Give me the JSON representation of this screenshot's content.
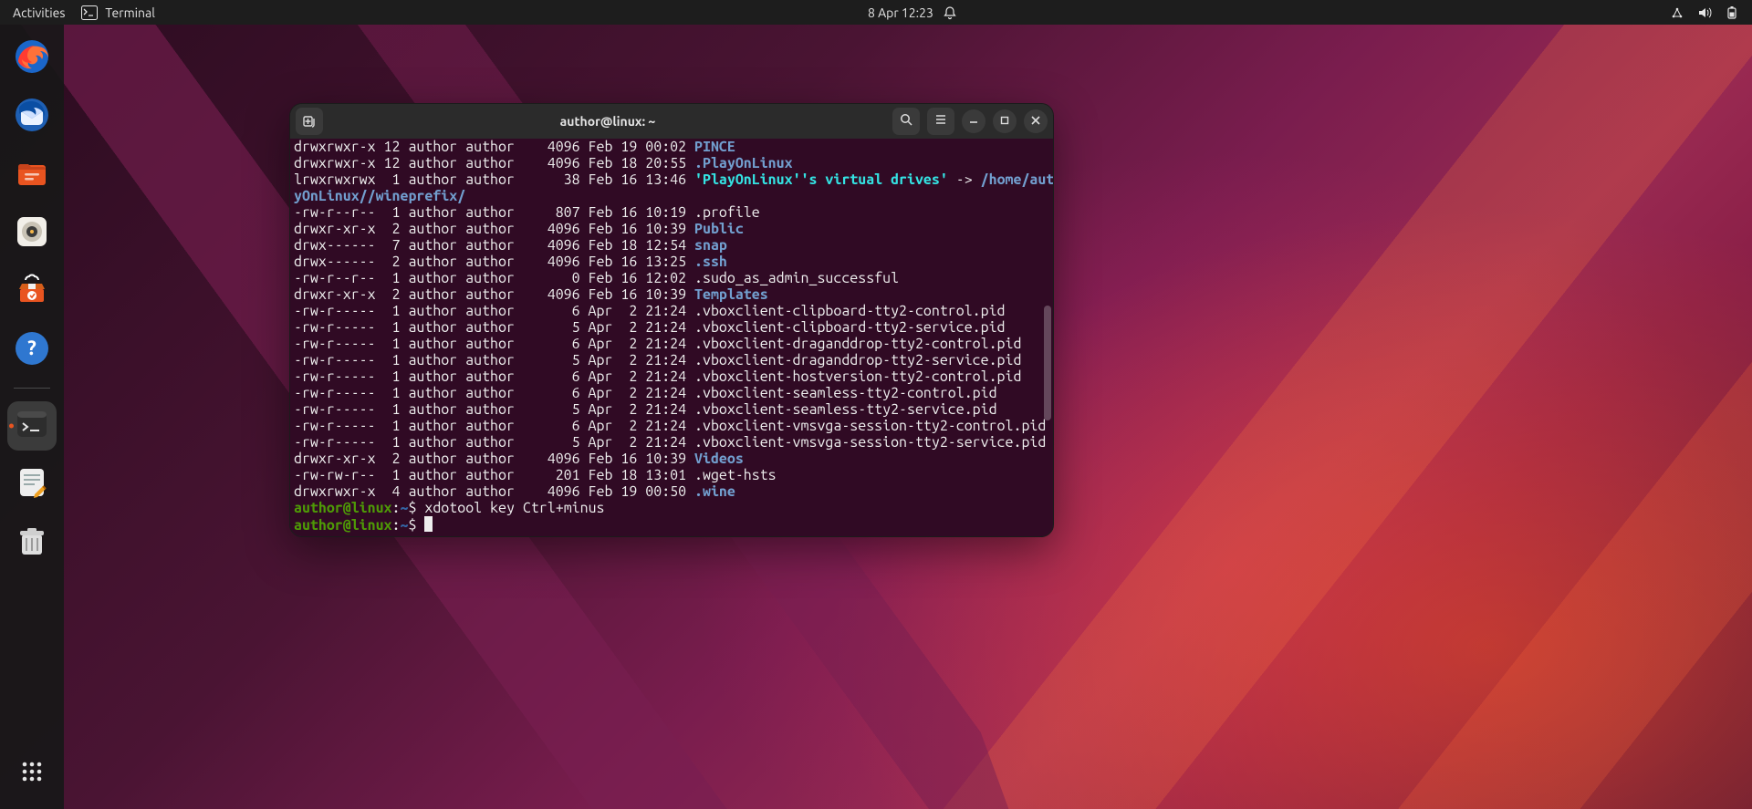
{
  "topbar": {
    "activities": "Activities",
    "app_name": "Terminal",
    "clock": "8 Apr  12:23"
  },
  "dock": {
    "apps": [
      {
        "id": "firefox",
        "name": "firefox-icon"
      },
      {
        "id": "thunderbird",
        "name": "thunderbird-icon"
      },
      {
        "id": "files",
        "name": "files-icon"
      },
      {
        "id": "rhythmbox",
        "name": "rhythmbox-icon"
      },
      {
        "id": "software",
        "name": "software-icon"
      },
      {
        "id": "help",
        "name": "help-icon"
      },
      {
        "id": "terminal",
        "name": "terminal-icon",
        "running": true,
        "active": true
      },
      {
        "id": "texteditor",
        "name": "text-editor-icon"
      },
      {
        "id": "trash",
        "name": "trash-icon"
      }
    ]
  },
  "window": {
    "title": "author@linux: ~"
  },
  "terminal": {
    "lines": [
      {
        "segs": [
          {
            "t": "drwxrwxr-x 12 author author    4096 Feb 19 00:02 "
          },
          {
            "t": "PINCE",
            "c": "dir"
          }
        ]
      },
      {
        "segs": [
          {
            "t": "drwxrwxr-x 12 author author    4096 Feb 18 20:55 "
          },
          {
            "t": ".PlayOnLinux",
            "c": "dir"
          }
        ]
      },
      {
        "segs": [
          {
            "t": "lrwxrwxrwx  1 author author      38 Feb 16 13:46 "
          },
          {
            "t": "'PlayOnLinux'\"'\"'s virtual drives'",
            "c": "link-name"
          },
          {
            "t": " -> "
          },
          {
            "t": "/home/author/.Pla",
            "c": "dir"
          }
        ]
      },
      {
        "segs": [
          {
            "t": "yOnLinux//wineprefix/",
            "c": "dir"
          }
        ]
      },
      {
        "segs": [
          {
            "t": "-rw-r--r--  1 author author     807 Feb 16 10:19 .profile"
          }
        ]
      },
      {
        "segs": [
          {
            "t": "drwxr-xr-x  2 author author    4096 Feb 16 10:39 "
          },
          {
            "t": "Public",
            "c": "dir"
          }
        ]
      },
      {
        "segs": [
          {
            "t": "drwx------  7 author author    4096 Feb 18 12:54 "
          },
          {
            "t": "snap",
            "c": "dir"
          }
        ]
      },
      {
        "segs": [
          {
            "t": "drwx------  2 author author    4096 Feb 16 13:25 "
          },
          {
            "t": ".ssh",
            "c": "dir"
          }
        ]
      },
      {
        "segs": [
          {
            "t": "-rw-r--r--  1 author author       0 Feb 16 12:02 .sudo_as_admin_successful"
          }
        ]
      },
      {
        "segs": [
          {
            "t": "drwxr-xr-x  2 author author    4096 Feb 16 10:39 "
          },
          {
            "t": "Templates",
            "c": "dir"
          }
        ]
      },
      {
        "segs": [
          {
            "t": "-rw-r-----  1 author author       6 Apr  2 21:24 .vboxclient-clipboard-tty2-control.pid"
          }
        ]
      },
      {
        "segs": [
          {
            "t": "-rw-r-----  1 author author       5 Apr  2 21:24 .vboxclient-clipboard-tty2-service.pid"
          }
        ]
      },
      {
        "segs": [
          {
            "t": "-rw-r-----  1 author author       6 Apr  2 21:24 .vboxclient-draganddrop-tty2-control.pid"
          }
        ]
      },
      {
        "segs": [
          {
            "t": "-rw-r-----  1 author author       5 Apr  2 21:24 .vboxclient-draganddrop-tty2-service.pid"
          }
        ]
      },
      {
        "segs": [
          {
            "t": "-rw-r-----  1 author author       6 Apr  2 21:24 .vboxclient-hostversion-tty2-control.pid"
          }
        ]
      },
      {
        "segs": [
          {
            "t": "-rw-r-----  1 author author       6 Apr  2 21:24 .vboxclient-seamless-tty2-control.pid"
          }
        ]
      },
      {
        "segs": [
          {
            "t": "-rw-r-----  1 author author       5 Apr  2 21:24 .vboxclient-seamless-tty2-service.pid"
          }
        ]
      },
      {
        "segs": [
          {
            "t": "-rw-r-----  1 author author       6 Apr  2 21:24 .vboxclient-vmsvga-session-tty2-control.pid"
          }
        ]
      },
      {
        "segs": [
          {
            "t": "-rw-r-----  1 author author       5 Apr  2 21:24 .vboxclient-vmsvga-session-tty2-service.pid"
          }
        ]
      },
      {
        "segs": [
          {
            "t": "drwxr-xr-x  2 author author    4096 Feb 16 10:39 "
          },
          {
            "t": "Videos",
            "c": "dir"
          }
        ]
      },
      {
        "segs": [
          {
            "t": "-rw-rw-r--  1 author author     201 Feb 18 13:01 .wget-hsts"
          }
        ]
      },
      {
        "segs": [
          {
            "t": "drwxrwxr-x  4 author author    4096 Feb 19 00:50 "
          },
          {
            "t": ".wine",
            "c": "dir"
          }
        ]
      },
      {
        "segs": [
          {
            "t": "author@linux",
            "c": "green"
          },
          {
            "t": ":"
          },
          {
            "t": "~",
            "c": "blue"
          },
          {
            "t": "$ xdotool key Ctrl+minus"
          }
        ]
      },
      {
        "segs": [
          {
            "t": "author@linux",
            "c": "green"
          },
          {
            "t": ":"
          },
          {
            "t": "~",
            "c": "blue"
          },
          {
            "t": "$ "
          }
        ],
        "cursor": true
      }
    ]
  }
}
